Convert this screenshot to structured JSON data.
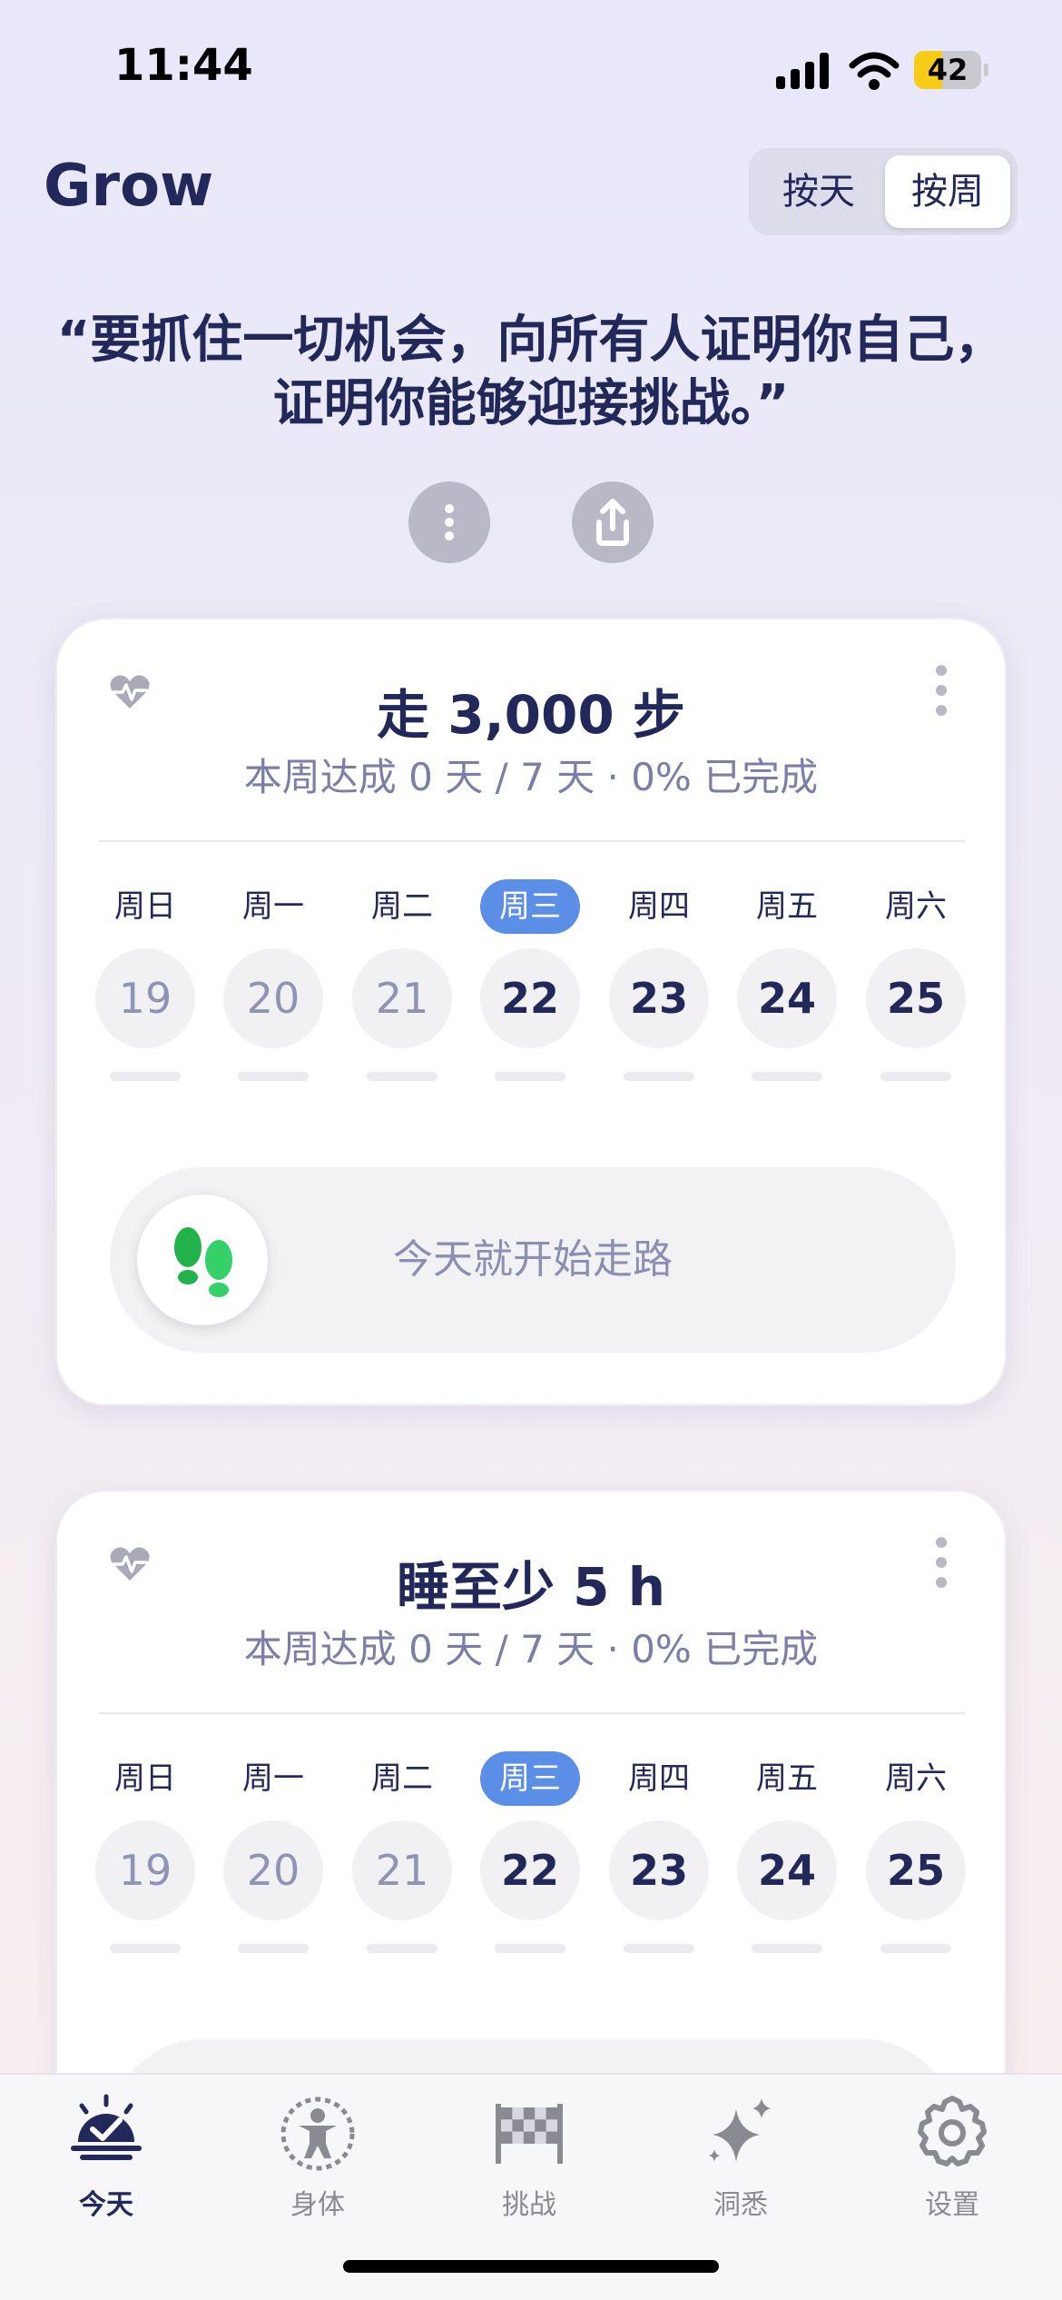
{
  "status": {
    "time": "11:44",
    "battery_level": "42"
  },
  "header": {
    "title": "Grow",
    "segments": [
      {
        "label": "按天",
        "selected": false
      },
      {
        "label": "按周",
        "selected": true
      }
    ]
  },
  "quote": {
    "text": "“要抓住一切机会，向所有人证明你自己，证明你能够迎接挑战。”"
  },
  "action_icons": [
    "more-vertical-icon",
    "share-icon"
  ],
  "cards": [
    {
      "title": "走 3,000 步",
      "subtitle": "本周达成  0 天 / 7 天  · 0% 已完成",
      "days": [
        {
          "label": "周日",
          "num": "19"
        },
        {
          "label": "周一",
          "num": "20"
        },
        {
          "label": "周二",
          "num": "21"
        },
        {
          "label": "周三",
          "num": "22"
        },
        {
          "label": "周四",
          "num": "23"
        },
        {
          "label": "周五",
          "num": "24"
        },
        {
          "label": "周六",
          "num": "25"
        }
      ],
      "today_index": 3,
      "cta_label": "今天就开始走路"
    },
    {
      "title": "睡至少 5 h",
      "subtitle": "本周达成  0 天 / 7 天  · 0% 已完成",
      "days": [
        {
          "label": "周日",
          "num": "19"
        },
        {
          "label": "周一",
          "num": "20"
        },
        {
          "label": "周二",
          "num": "21"
        },
        {
          "label": "周三",
          "num": "22"
        },
        {
          "label": "周四",
          "num": "23"
        },
        {
          "label": "周五",
          "num": "24"
        },
        {
          "label": "周六",
          "num": "25"
        }
      ],
      "today_index": 3
    }
  ],
  "tabs": [
    {
      "label": "今天",
      "icon": "today-icon",
      "active": true
    },
    {
      "label": "身体",
      "icon": "body-icon",
      "active": false
    },
    {
      "label": "挑战",
      "icon": "checkered-flag-icon",
      "active": false
    },
    {
      "label": "洞悉",
      "icon": "sparkle-icon",
      "active": false
    },
    {
      "label": "设置",
      "icon": "gear-icon",
      "active": false
    }
  ],
  "colors": {
    "accent": "#5b8ee6",
    "text": "#23285a",
    "green": "#2fc654",
    "battery": "#f7cc16"
  }
}
